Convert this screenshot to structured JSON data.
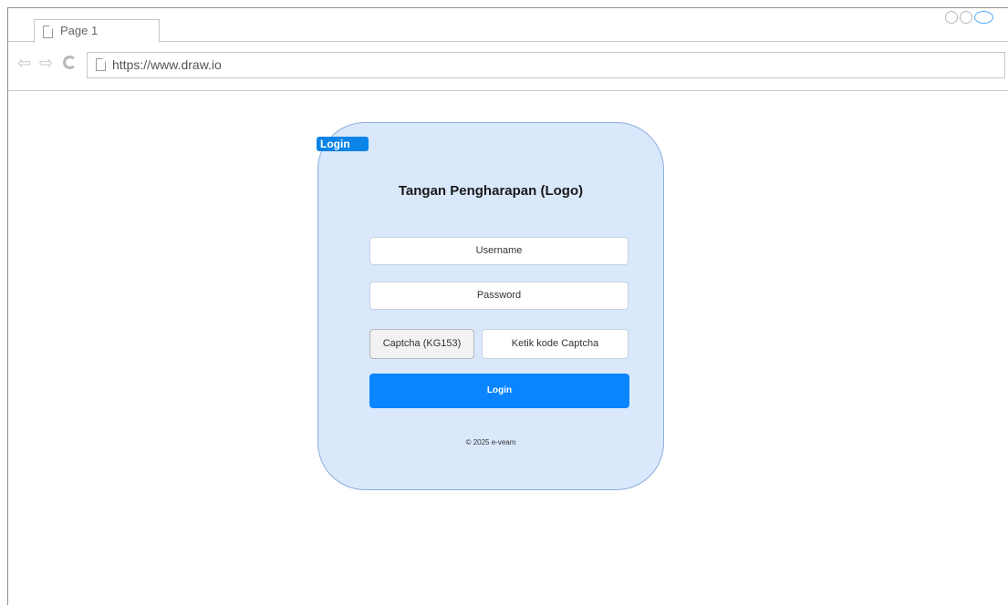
{
  "browser": {
    "tab_label": "Page 1",
    "url": "https://www.draw.io",
    "icons": {
      "back": "back-arrow-icon",
      "forward": "forward-arrow-icon",
      "refresh": "refresh-icon",
      "page": "page-icon"
    }
  },
  "login_form": {
    "tag": "Login",
    "title": "Tangan Pengharapan (Logo)",
    "username_placeholder": "Username",
    "password_placeholder": "Password",
    "captcha_label": "Captcha (KG153)",
    "captcha_placeholder": "Ketik kode Captcha",
    "submit_label": "Login",
    "footer": "© 2025 e-veam"
  },
  "colors": {
    "card_bg": "#dae8fc",
    "primary": "#0a84ff"
  }
}
